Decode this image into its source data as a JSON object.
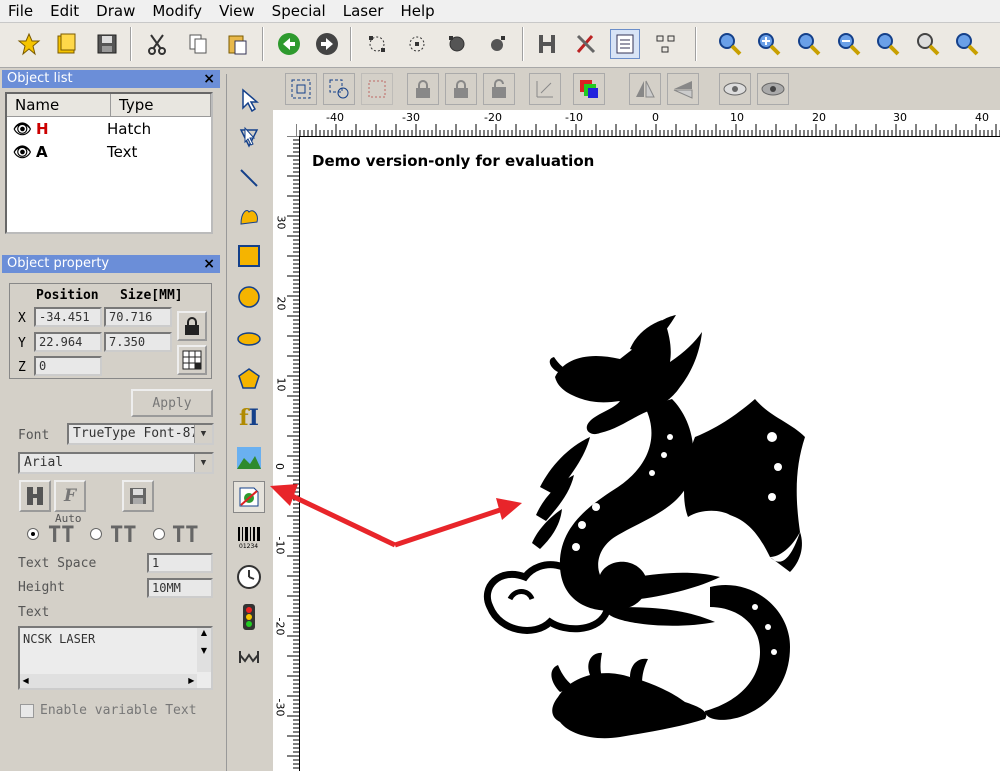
{
  "menu": [
    "File",
    "Edit",
    "Draw",
    "Modify",
    "View",
    "Special",
    "Laser",
    "Help"
  ],
  "object_list": {
    "title": "Object list",
    "close": "×",
    "col_name": "Name",
    "col_type": "Type",
    "rows": [
      {
        "name": "H",
        "type": "Hatch"
      },
      {
        "name": "A",
        "type": "Text"
      }
    ]
  },
  "object_property": {
    "title": "Object property",
    "close": "×",
    "position_label": "Position",
    "size_label": "Size[MM]",
    "x_label": "X",
    "y_label": "Y",
    "z_label": "Z",
    "x_pos": "-34.451",
    "x_size": "70.716",
    "y_pos": "22.964",
    "y_size": "7.350",
    "z_pos": "0",
    "apply": "Apply",
    "font_label": "Font",
    "font_type": "TrueType Font-87",
    "font_name": "Arial",
    "auto_label": "Auto",
    "text_space_label": "Text Space",
    "text_space_value": "1",
    "height_label": "Height",
    "height_value": "10MM",
    "text_label": "Text",
    "text_value": "NCSK LASER",
    "enable_variable": "Enable variable Text"
  },
  "canvas": {
    "watermark": "Demo version-only for evaluation",
    "h_ticks": [
      "-40",
      "-30",
      "-20",
      "-10",
      "0",
      "10",
      "20",
      "30",
      "40"
    ],
    "v_ticks": [
      "30",
      "20",
      "10",
      "0",
      "-10",
      "-20",
      "-30"
    ]
  },
  "colors": {
    "panel_title_bg": "#6b8ed8",
    "arrow": "#e8252a"
  }
}
